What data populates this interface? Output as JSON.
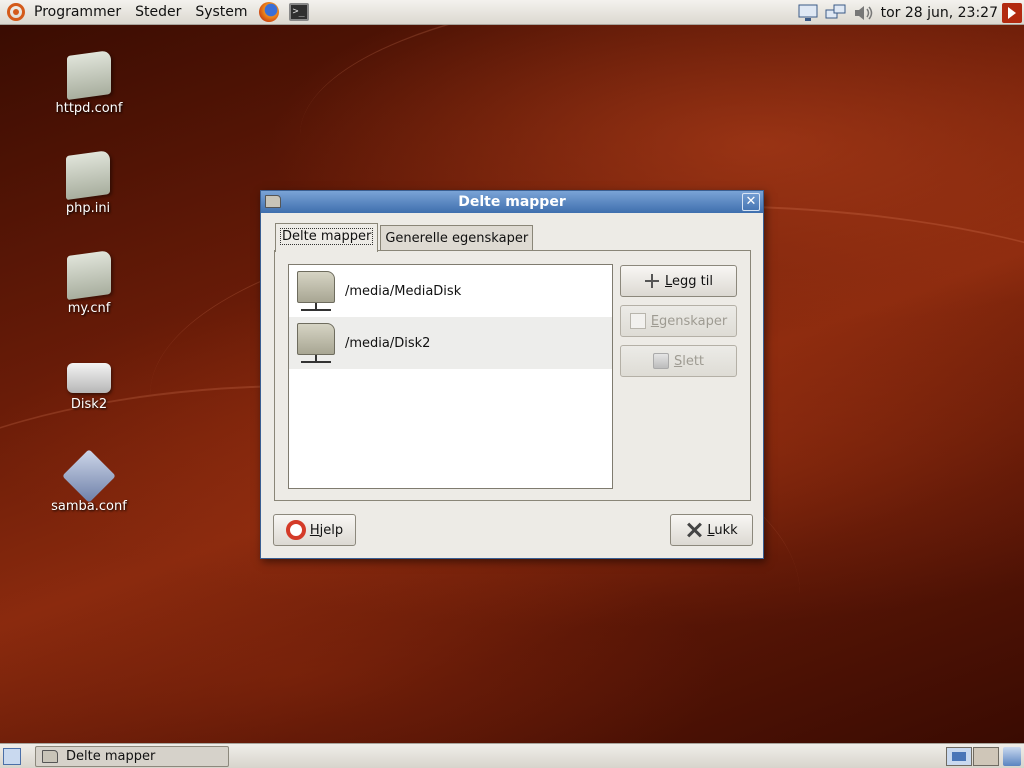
{
  "top_panel": {
    "menus": [
      "Programmer",
      "Steder",
      "System"
    ],
    "clock": "tor 28 jun, 23:27"
  },
  "desktop_icons": [
    "httpd.conf",
    "php.ini",
    "my.cnf",
    "Disk2",
    "samba.conf"
  ],
  "dialog": {
    "title": "Delte mapper",
    "tabs": [
      "Delte mapper",
      "Generelle egenskaper"
    ],
    "shares": [
      "/media/MediaDisk",
      "/media/Disk2"
    ],
    "buttons": {
      "add_key": "L",
      "add_rest": "egg til",
      "props_key": "E",
      "props_rest": "genskaper",
      "delete_key": "S",
      "delete_rest": "lett",
      "help_key": "H",
      "help_rest": "jelp",
      "close_key": "L",
      "close_rest": "ukk"
    }
  },
  "taskbar": {
    "window_title": "Delte mapper"
  },
  "colors": {
    "titlebar": "#3f6fae",
    "desktop": "#6a1c08"
  }
}
